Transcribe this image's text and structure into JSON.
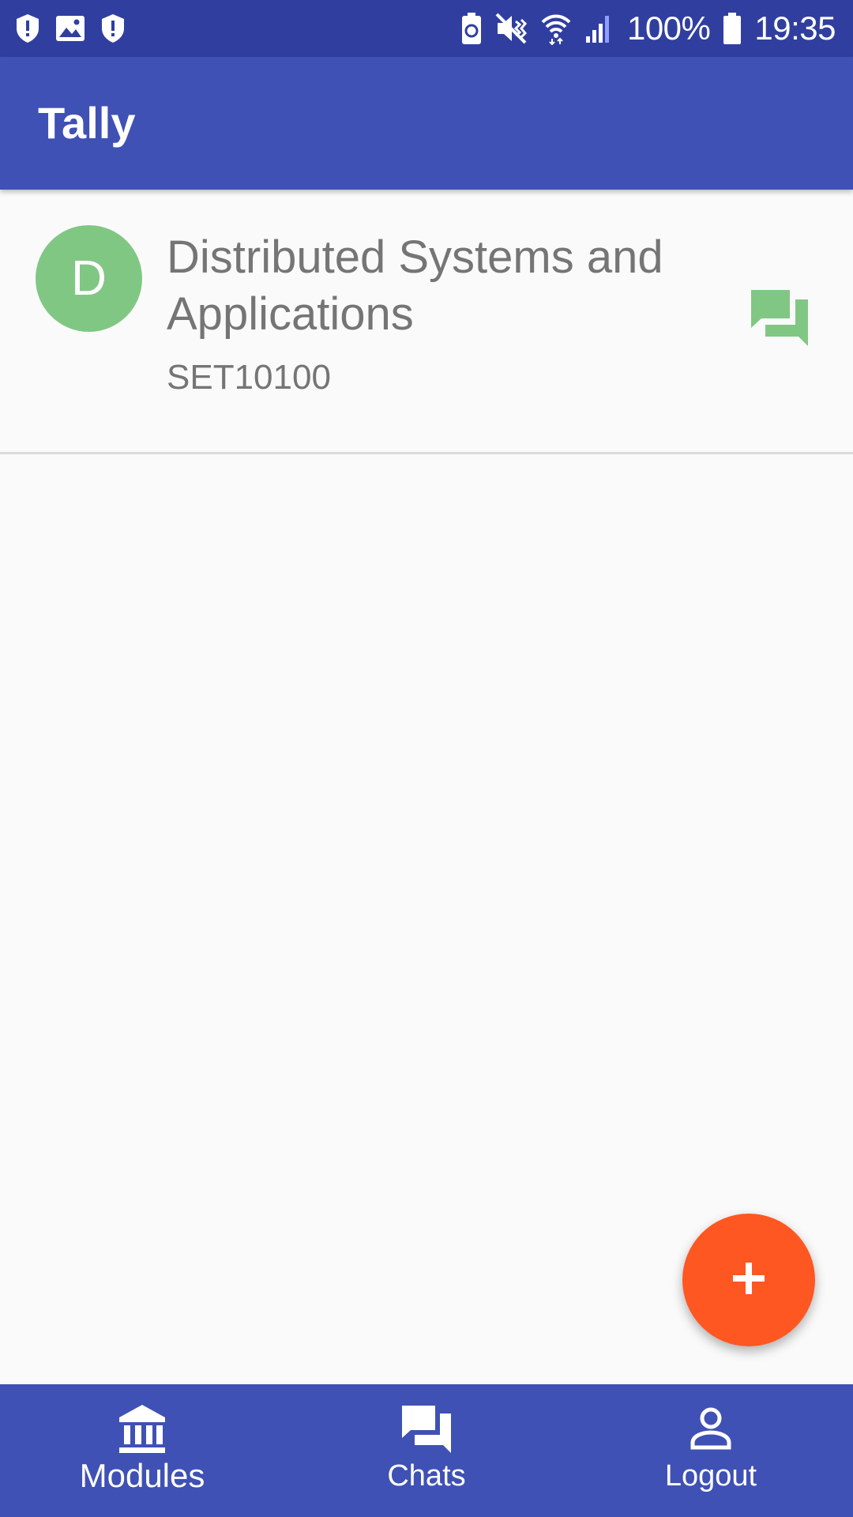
{
  "status_bar": {
    "left_icons": [
      "shield-alert-icon",
      "image-icon",
      "shield-alert-icon"
    ],
    "right_icons": [
      "battery-saver-icon",
      "vibrate-icon",
      "wifi-icon",
      "signal-icon",
      "battery-icon"
    ],
    "battery_percent": "100%",
    "time": "19:35"
  },
  "app_bar": {
    "title": "Tally"
  },
  "modules": [
    {
      "avatar_letter": "D",
      "avatar_color": "#81c784",
      "title": "Distributed Systems and Applications",
      "code": "SET10100",
      "action_icon": "forum-icon"
    }
  ],
  "fab": {
    "icon": "plus-icon",
    "color": "#ff5722"
  },
  "bottom_nav": {
    "items": [
      {
        "label": "Modules",
        "icon": "bank-icon",
        "active": true
      },
      {
        "label": "Chats",
        "icon": "forum-icon",
        "active": false
      },
      {
        "label": "Logout",
        "icon": "person-icon",
        "active": false
      }
    ]
  },
  "colors": {
    "primary": "#3f51b5",
    "primary_dark": "#303f9f",
    "accent": "#ff5722"
  }
}
